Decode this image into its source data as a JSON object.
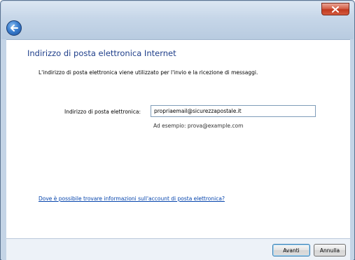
{
  "window": {
    "close_icon": "close-icon",
    "back_icon": "back-arrow-icon"
  },
  "page": {
    "title": "Indirizzo di posta elettronica Internet",
    "description": "L'indirizzo di posta elettronica viene utilizzato per l'invio e la ricezione di messaggi."
  },
  "form": {
    "email_label": "Indirizzo di posta elettronica:",
    "email_value": "propriaemail@sicurezzapostale.it",
    "example_text": "Ad esempio: prova@example.com"
  },
  "help": {
    "link_text": "Dove è possibile trovare informazioni sull'account di posta elettronica?"
  },
  "buttons": {
    "next_label": "Avanti",
    "cancel_label": "Annulla"
  },
  "colors": {
    "title": "#1e3e8a",
    "link": "#0645ad",
    "close_button": "#c0391f"
  }
}
